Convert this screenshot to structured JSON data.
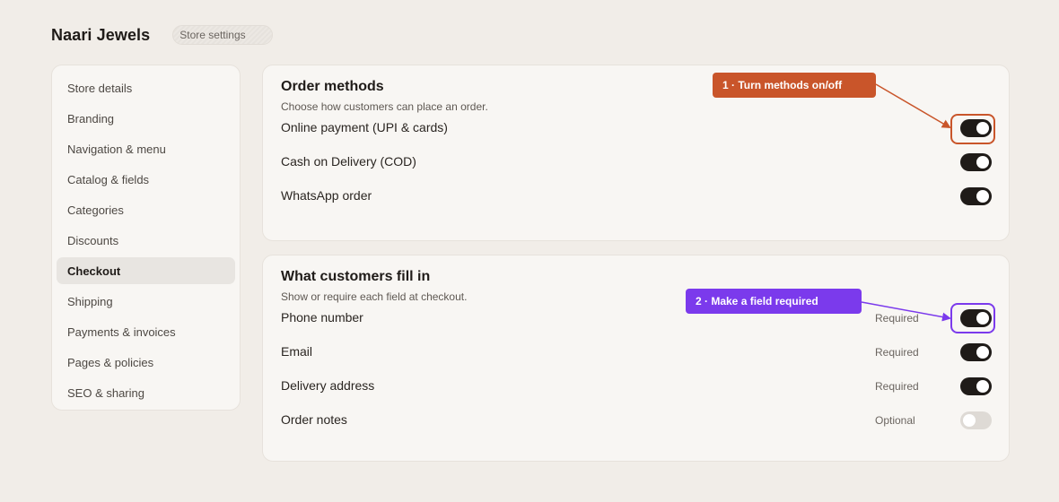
{
  "header": {
    "brand": "Naari Jewels",
    "breadcrumb": "Store settings"
  },
  "sidebar": {
    "items": [
      {
        "label": "Store details"
      },
      {
        "label": "Branding"
      },
      {
        "label": "Navigation & menu"
      },
      {
        "label": "Catalog & fields"
      },
      {
        "label": "Categories"
      },
      {
        "label": "Discounts"
      },
      {
        "label": "Checkout"
      },
      {
        "label": "Shipping"
      },
      {
        "label": "Payments & invoices"
      },
      {
        "label": "Pages & policies"
      },
      {
        "label": "SEO & sharing"
      }
    ],
    "active": "Checkout"
  },
  "order_methods": {
    "title": "Order methods",
    "subtitle": "Choose how customers can place an order.",
    "rows": [
      {
        "label": "Online payment (UPI & cards)",
        "enabled": true
      },
      {
        "label": "Cash on Delivery (COD)",
        "enabled": true
      },
      {
        "label": "WhatsApp order",
        "enabled": true
      }
    ]
  },
  "fields": {
    "title": "What customers fill in",
    "subtitle": "Show or require each field at checkout.",
    "rows": [
      {
        "label": "Phone number",
        "status": "Required",
        "enabled": true
      },
      {
        "label": "Email",
        "status": "Required",
        "enabled": true
      },
      {
        "label": "Delivery address",
        "status": "Required",
        "enabled": true
      },
      {
        "label": "Order notes",
        "status": "Optional",
        "enabled": false
      }
    ]
  },
  "annotations": {
    "step1": "1 · Turn methods on/off",
    "step2": "2 · Make a field required",
    "colors": {
      "step1": "#c9552a",
      "step2": "#7b3aec"
    }
  },
  "colors": {
    "background": "#f1ede8",
    "card": "#f8f6f3",
    "toggle_on": "#1f1b18",
    "toggle_off": "#dedad5"
  }
}
